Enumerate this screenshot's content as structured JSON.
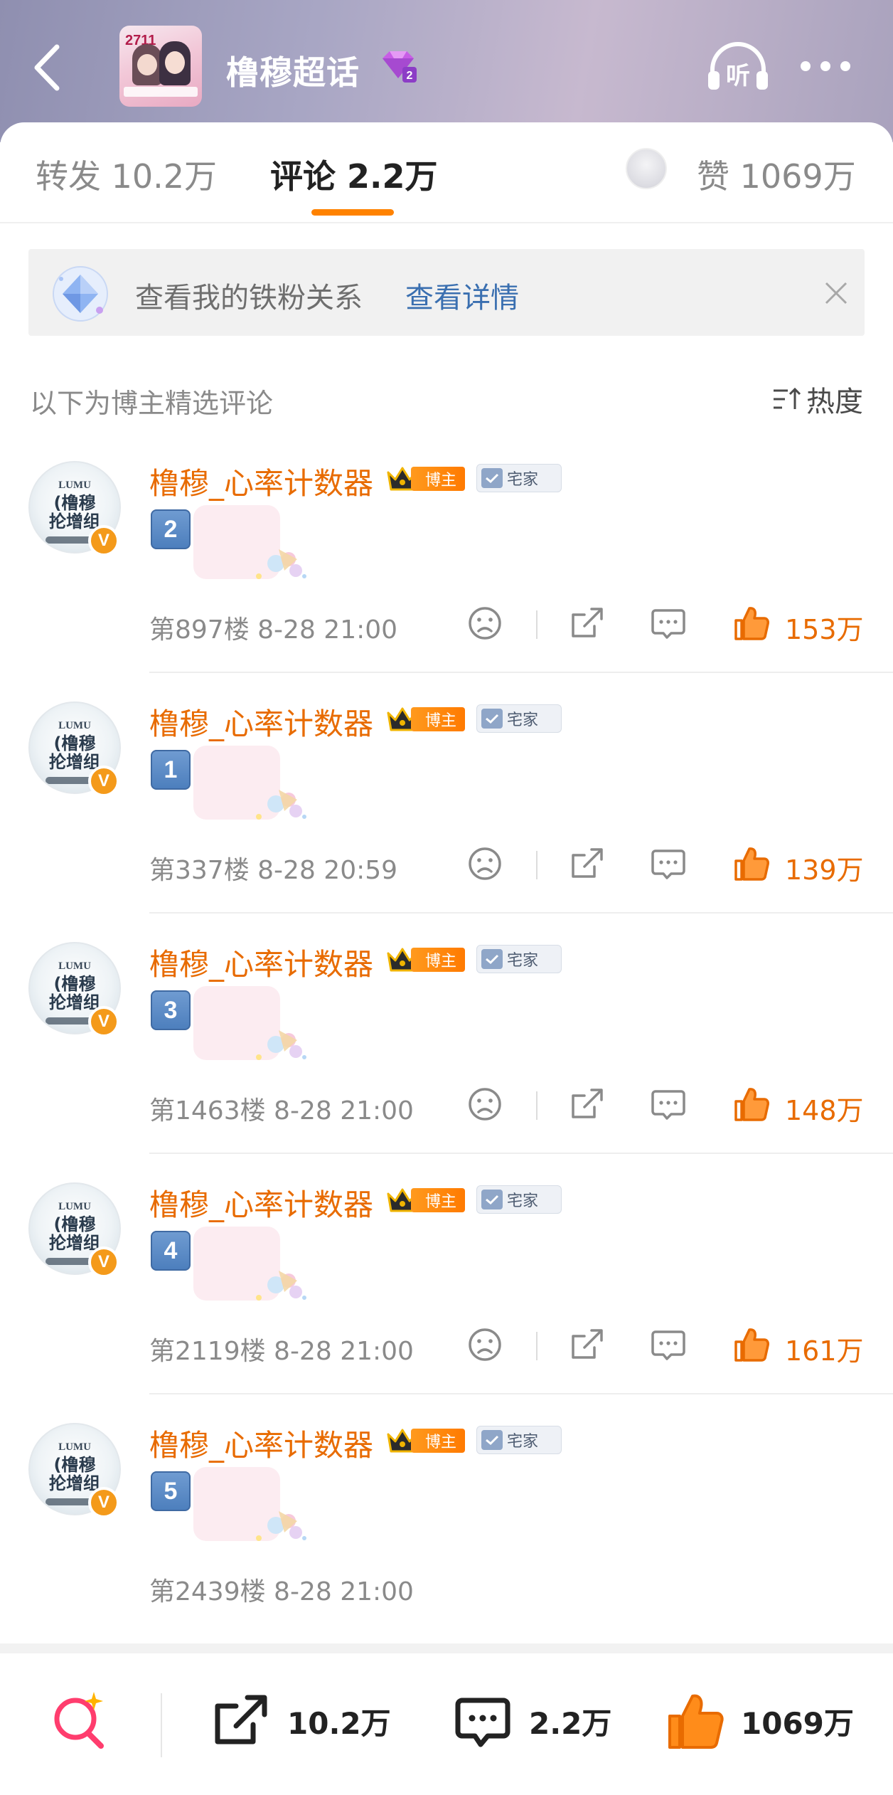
{
  "header": {
    "title": "橹穆超话",
    "cover_text": "2711",
    "gem_level": "2",
    "listen_label": "听"
  },
  "tabs": {
    "repost": "转发 10.2万",
    "comment": "评论 2.2万",
    "likes": "赞 1069万"
  },
  "banner": {
    "text": "查看我的铁粉关系",
    "link": "查看详情"
  },
  "section": {
    "title": "以下为博主精选评论",
    "sort_label": "热度"
  },
  "avatar": {
    "line1": "LUMU",
    "line2": "(橹穆",
    "line3": "抡增组"
  },
  "badges": {
    "owner": "博主",
    "home": "宅家",
    "v": "V"
  },
  "comments": [
    {
      "user": "橹穆_心率计数器",
      "sticker": "2",
      "meta": "第897楼 8-28 21:00",
      "likes": "153万"
    },
    {
      "user": "橹穆_心率计数器",
      "sticker": "1",
      "meta": "第337楼 8-28 20:59",
      "likes": "139万"
    },
    {
      "user": "橹穆_心率计数器",
      "sticker": "3",
      "meta": "第1463楼 8-28 21:00",
      "likes": "148万"
    },
    {
      "user": "橹穆_心率计数器",
      "sticker": "4",
      "meta": "第2119楼 8-28 21:00",
      "likes": "161万"
    },
    {
      "user": "橹穆_心率计数器",
      "sticker": "5",
      "meta": "第2439楼 8-28 21:00",
      "likes": ""
    }
  ],
  "bottom_bar": {
    "repost_count": "10.2万",
    "comment_count": "2.2万",
    "like_count": "1069万"
  },
  "colors": {
    "accent": "#ff8200",
    "username": "#e86b00",
    "link": "#3a6fb0"
  },
  "icons": [
    "back-arrow-icon",
    "gem-icon",
    "headphones-icon",
    "more-dots-icon",
    "diamond-icon",
    "close-icon",
    "sort-icon",
    "crown-icon",
    "check-icon",
    "sad-face-icon",
    "share-icon",
    "comment-icon",
    "thumbs-up-icon",
    "search-sparkle-icon"
  ]
}
